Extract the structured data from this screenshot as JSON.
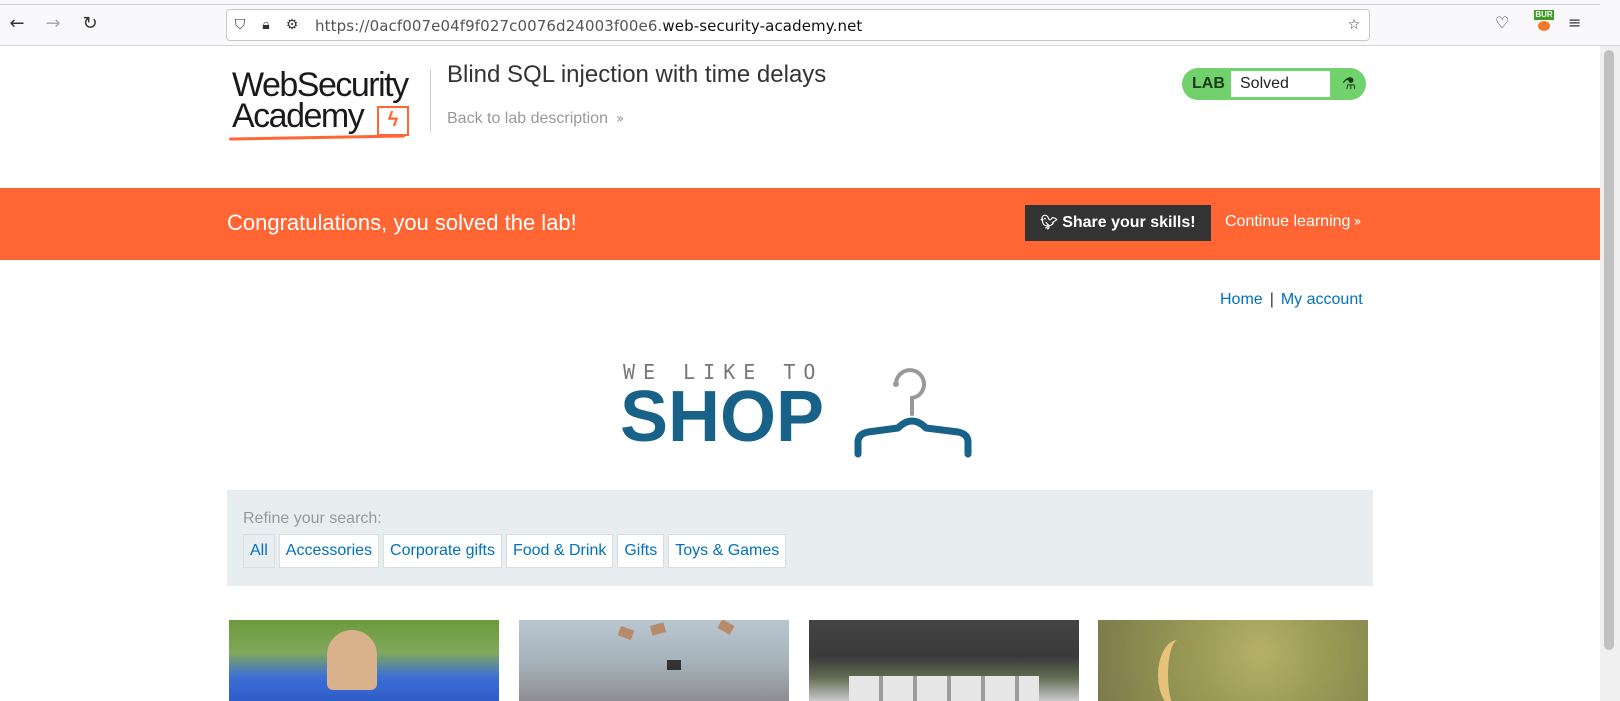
{
  "browser": {
    "url_prefix": "https://0acf007e04f9f027c0076d24003f00e6.",
    "url_domain": "web-security-academy.net",
    "burp_badge": "BUR"
  },
  "lab_header": {
    "logo_line1": "WebSecurity",
    "logo_line2": "Academy",
    "title": "Blind SQL injection with time delays",
    "back_link": "Back to lab description",
    "status_label": "LAB",
    "status_value": "Solved"
  },
  "notification": {
    "message": "Congratulations, you solved the lab!",
    "share_button": "Share your skills!",
    "continue_link": "Continue learning"
  },
  "nav": {
    "home": "Home",
    "separator": "|",
    "my_account": "My account"
  },
  "shop_logo": {
    "tagline": "WE LIKE TO",
    "name": "SHOP"
  },
  "search": {
    "label": "Refine your search:",
    "filters": [
      "All",
      "Accessories",
      "Corporate gifts",
      "Food & Drink",
      "Gifts",
      "Toys & Games"
    ]
  },
  "colors": {
    "accent_orange": "#ff6633",
    "link_blue": "#0071bc",
    "lab_green": "#70d16d",
    "shop_blue": "#18628a"
  }
}
